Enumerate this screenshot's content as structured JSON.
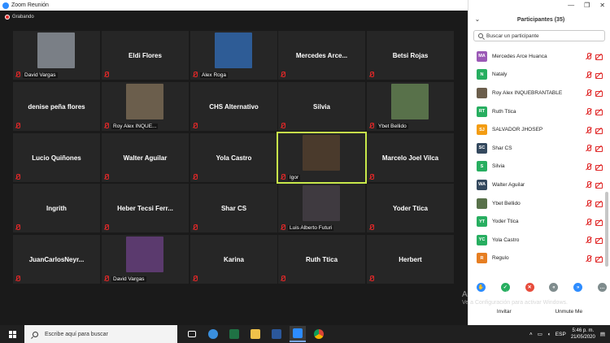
{
  "window": {
    "title": "Zoom Reunión"
  },
  "recording": {
    "label": "Grabando"
  },
  "tiles": [
    {
      "name": "",
      "tag": "David Vargas",
      "photo": "#7a7f86"
    },
    {
      "name": "Eldi Flores",
      "tag": ""
    },
    {
      "name": "",
      "tag": "Alex Roga",
      "photo": "#2e5c96"
    },
    {
      "name": "Mercedes  Arce...",
      "tag": ""
    },
    {
      "name": "Betsi Rojas",
      "tag": ""
    },
    {
      "name": "denise peña flores",
      "tag": ""
    },
    {
      "name": "",
      "tag": "Roy Alex INQUE...",
      "photo": "#6b5e4c"
    },
    {
      "name": "CHS Alternativo",
      "tag": ""
    },
    {
      "name": "Silvia",
      "tag": ""
    },
    {
      "name": "",
      "tag": "Ybet Bellido",
      "photo": "#58714a"
    },
    {
      "name": "Lucio Quiñones",
      "tag": ""
    },
    {
      "name": "Walter Aguilar",
      "tag": ""
    },
    {
      "name": "Yola Castro",
      "tag": ""
    },
    {
      "name": "",
      "tag": "Igor",
      "photo": "#4a3a2c",
      "active": true
    },
    {
      "name": "Marcelo Joel Vilca",
      "tag": ""
    },
    {
      "name": "Ingrith",
      "tag": ""
    },
    {
      "name": "Heber  Tecsi  Ferr...",
      "tag": ""
    },
    {
      "name": "Shar CS",
      "tag": ""
    },
    {
      "name": "",
      "tag": "Luis Alberto Futuri",
      "photo": "#3f3a40"
    },
    {
      "name": "Yoder Ttica",
      "tag": ""
    },
    {
      "name": "JuanCarlosNeyr...",
      "tag": ""
    },
    {
      "name": "",
      "tag": "David Vargas",
      "photo": "#5b3a6e"
    },
    {
      "name": "Karina",
      "tag": ""
    },
    {
      "name": "Ruth Ttica",
      "tag": ""
    },
    {
      "name": "Herbert",
      "tag": ""
    }
  ],
  "panel": {
    "title": "Participantes (35)",
    "search_placeholder": "Buscar un participante",
    "participants": [
      {
        "initials": "MA",
        "name": "Mercedes Arce Huanca",
        "color": "#9b59b6"
      },
      {
        "initials": "N",
        "name": "Nataly",
        "color": "#27ae60"
      },
      {
        "initials": "",
        "name": "Roy Alex INQUEBRANTABLE",
        "color": "#6b5e4c"
      },
      {
        "initials": "RT",
        "name": "Ruth Ttica",
        "color": "#27ae60"
      },
      {
        "initials": "SJ",
        "name": "SALVADOR JHOSEP",
        "color": "#f39c12"
      },
      {
        "initials": "SC",
        "name": "Shar CS",
        "color": "#34495e"
      },
      {
        "initials": "S",
        "name": "Silvia",
        "color": "#27ae60"
      },
      {
        "initials": "WA",
        "name": "Walter Aguilar",
        "color": "#34495e"
      },
      {
        "initials": "",
        "name": "Ybet Bellido",
        "color": "#58714a"
      },
      {
        "initials": "YT",
        "name": "Yoder Ttica",
        "color": "#27ae60"
      },
      {
        "initials": "YC",
        "name": "Yola Castro",
        "color": "#27ae60"
      },
      {
        "initials": "R",
        "name": "Regulo",
        "color": "#e67e22"
      }
    ],
    "reactions": [
      {
        "icon": "raise-hand-icon",
        "color": "#2d8cff",
        "glyph": "✋"
      },
      {
        "icon": "yes-icon",
        "color": "#27ae60",
        "glyph": "✓"
      },
      {
        "icon": "no-icon",
        "color": "#e74c3c",
        "glyph": "✕"
      },
      {
        "icon": "slower-icon",
        "color": "#7f8c8d",
        "glyph": "«"
      },
      {
        "icon": "faster-icon",
        "color": "#2d8cff",
        "glyph": "»"
      },
      {
        "icon": "more-icon",
        "color": "#7f8c8d",
        "glyph": "…"
      }
    ],
    "invite_label": "Invitar",
    "unmute_label": "Unmute Me"
  },
  "watermark": {
    "title": "Activar Windows",
    "sub": "Ve a Configuración para activar Windows."
  },
  "taskbar": {
    "search_placeholder": "Escribe aquí para buscar",
    "lang": "ESP",
    "time": "5:46 p. m.",
    "date": "21/05/2020"
  }
}
